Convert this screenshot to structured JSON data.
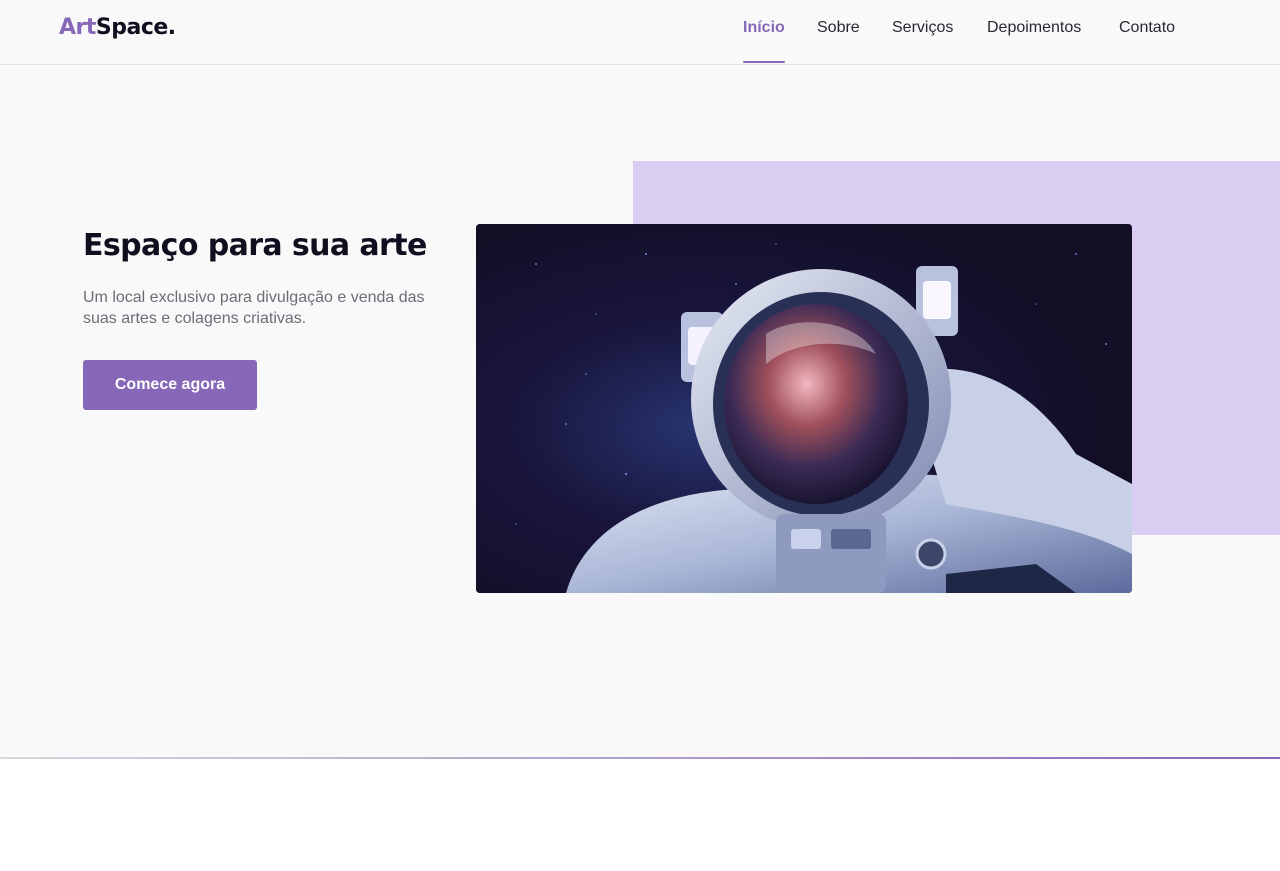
{
  "header": {
    "logo": {
      "accent": "Art",
      "rest": "Space."
    },
    "nav": [
      {
        "label": "Início",
        "active": true
      },
      {
        "label": "Sobre",
        "active": false
      },
      {
        "label": "Serviços",
        "active": false
      },
      {
        "label": "Depoimentos",
        "active": false
      },
      {
        "label": "Contato",
        "active": false
      }
    ]
  },
  "hero": {
    "title": "Espaço para sua arte",
    "subtitle": "Um local exclusivo para divulgação e venda das suas artes e colagens criativas.",
    "cta_label": "Comece agora",
    "image_subject": "astronaut-in-space"
  },
  "colors": {
    "accent": "#8667b8",
    "accent_light": "#d9cef2",
    "text_dark": "#120e1f",
    "text_muted": "#6e6b78",
    "background": "#f9f9f9"
  }
}
